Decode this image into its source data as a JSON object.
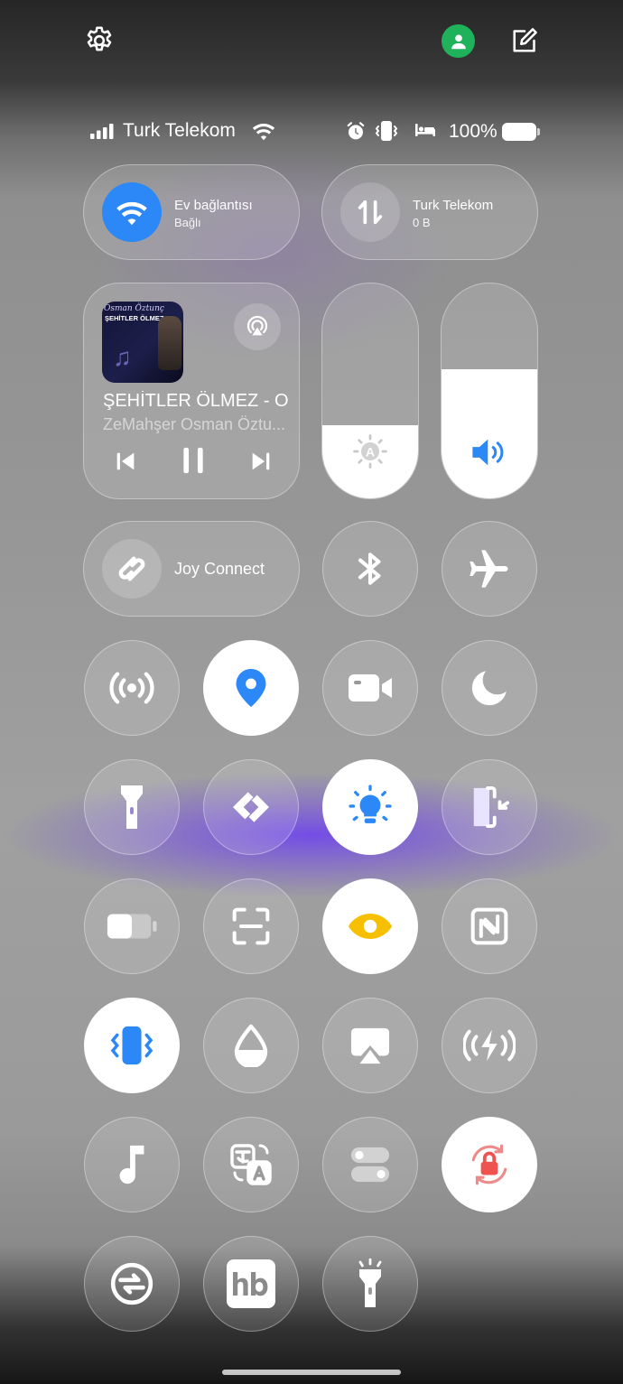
{
  "header": {
    "settings_icon": "gear-icon",
    "profile_icon": "user-icon",
    "profile_color": "#20B25A",
    "edit_icon": "edit-icon"
  },
  "status_bar": {
    "carrier": "Turk Telekom",
    "battery": "100%"
  },
  "wifi_tile": {
    "name": "Ev bağlantısı",
    "status": "Bağlı",
    "accent": "#2B88F6"
  },
  "mobile_data_tile": {
    "name": "Turk Telekom",
    "usage": "0 B"
  },
  "media": {
    "album_artist": "Osman Öztunç",
    "album_title": "ŞEHİTLER ÖLMEZ.",
    "title": "ŞEHİTLER ÖLMEZ - O...",
    "artist": "ZeMahşer Osman Öztu..."
  },
  "sliders": {
    "brightness_level": 0.34,
    "volume_level": 0.6
  },
  "joy_connect": {
    "label": "Joy Connect"
  },
  "toggles": [
    {
      "name": "bluetooth",
      "icon": "bluetooth-icon",
      "active": false
    },
    {
      "name": "airplane-mode",
      "icon": "airplane-icon",
      "active": false
    },
    {
      "name": "hotspot",
      "icon": "hotspot-icon",
      "active": false
    },
    {
      "name": "location",
      "icon": "location-pin-icon",
      "active": true
    },
    {
      "name": "screen-recorder",
      "icon": "video-camera-icon",
      "active": false
    },
    {
      "name": "do-not-disturb",
      "icon": "moon-icon",
      "active": false
    },
    {
      "name": "flashlight",
      "icon": "flashlight-icon",
      "active": false
    },
    {
      "name": "link-share",
      "icon": "link-icon",
      "active": false
    },
    {
      "name": "eye-protection",
      "icon": "bulb-icon",
      "active": true
    },
    {
      "name": "edge-panel",
      "icon": "edge-panel-icon",
      "active": false
    },
    {
      "name": "battery-saver",
      "icon": "battery-icon",
      "active": false
    },
    {
      "name": "screenshot",
      "icon": "scan-icon",
      "active": false
    },
    {
      "name": "reading-mode",
      "icon": "eye-icon",
      "active": true
    },
    {
      "name": "nfc",
      "icon": "nfc-icon",
      "active": false
    },
    {
      "name": "vibrate",
      "icon": "vibrate-icon",
      "active": true
    },
    {
      "name": "ink-mode",
      "icon": "drop-icon",
      "active": false
    },
    {
      "name": "screen-cast",
      "icon": "screencast-icon",
      "active": false
    },
    {
      "name": "power-share",
      "icon": "power-share-icon",
      "active": false
    },
    {
      "name": "music",
      "icon": "music-note-icon",
      "active": false
    },
    {
      "name": "translate",
      "icon": "translate-icon",
      "active": false
    },
    {
      "name": "toggle-switch",
      "icon": "switch-icon",
      "active": false
    },
    {
      "name": "rotation-lock",
      "icon": "rotation-lock-icon",
      "active": true
    },
    {
      "name": "sync",
      "icon": "sync-icon",
      "active": false
    },
    {
      "name": "hepsiburada",
      "icon": "hb-icon",
      "active": false
    },
    {
      "name": "torch",
      "icon": "torch-icon",
      "active": false
    }
  ],
  "colors": {
    "accent_blue": "#2B88F6",
    "reading_yellow": "#F6C000",
    "lock_red": "#EF5350"
  }
}
